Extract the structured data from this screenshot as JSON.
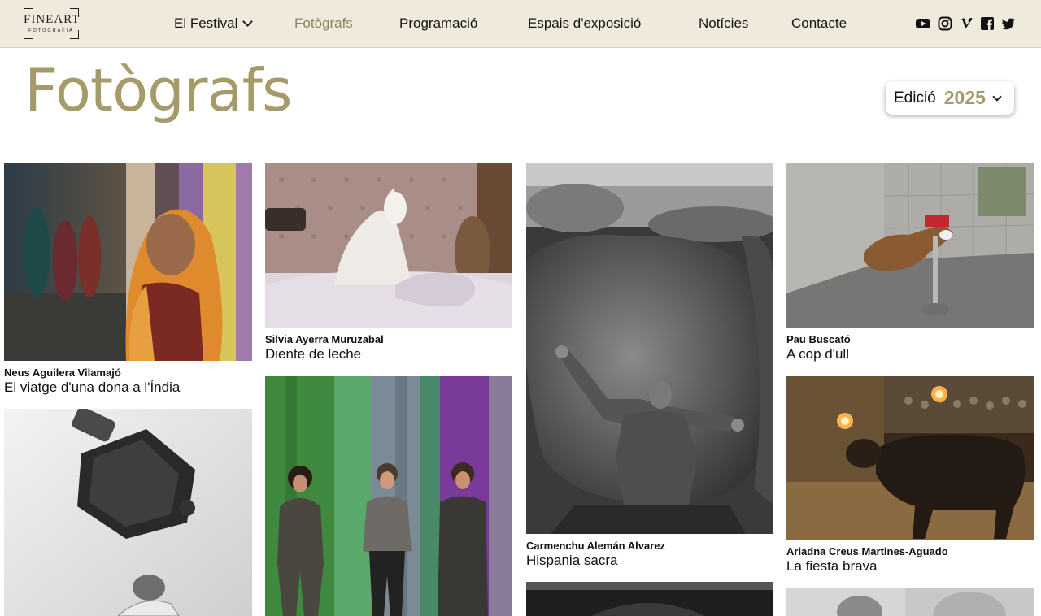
{
  "nav": {
    "logo_main": "FINEART",
    "logo_sub": "FOTOGRAFIA",
    "items": [
      {
        "label": "El Festival"
      },
      {
        "label": "Fotògrafs"
      },
      {
        "label": "Programació"
      },
      {
        "label": "Espais d'exposició"
      },
      {
        "label": "Notícies"
      },
      {
        "label": "Contacte"
      }
    ],
    "social_icons": [
      "youtube-icon",
      "instagram-icon",
      "vimeo-icon",
      "facebook-icon",
      "twitter-icon"
    ]
  },
  "page": {
    "title": "Fotògrafs",
    "edition_label": "Edició",
    "edition_value": "2025"
  },
  "photographers": [
    {
      "name": "Neus Aguilera Vilamajó",
      "title": "El viatge d'una dona a l'Índia"
    },
    {
      "name": "Silvia Ayerra Muruzabal",
      "title": "Diente de leche"
    },
    {
      "name": "Carmenchu Alemán Alvarez",
      "title": "Hispania sacra"
    },
    {
      "name": "Pau Buscató",
      "title": "A cop d'ull"
    },
    {
      "name": "Ariadna Creus Martines-Aguado",
      "title": "La fiesta brava"
    }
  ],
  "colors": {
    "accent": "#a59a69",
    "topbar": "#efeadb"
  }
}
